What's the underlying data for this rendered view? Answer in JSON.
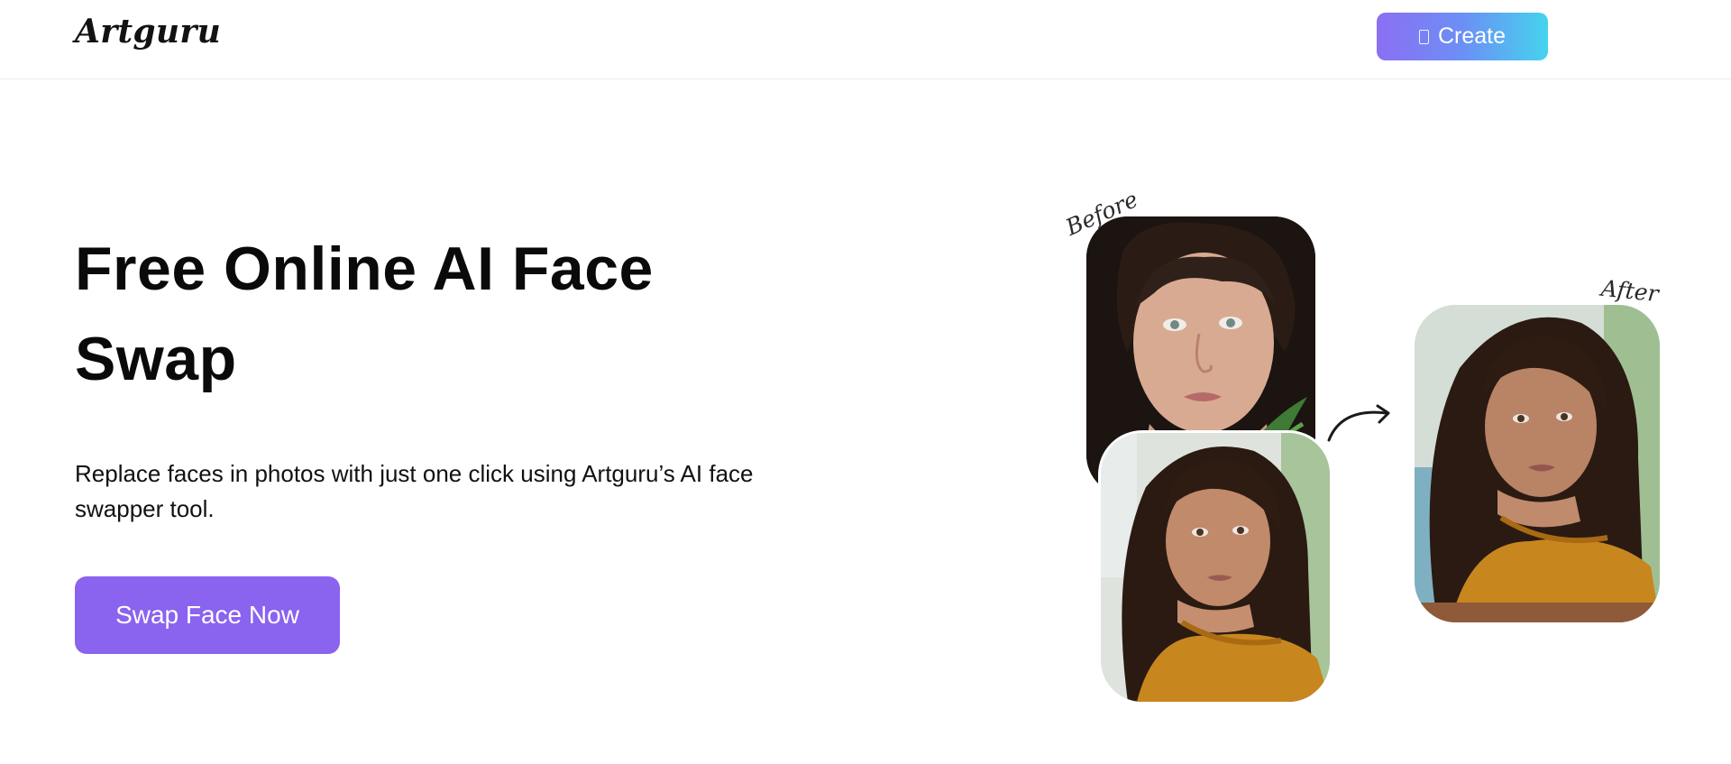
{
  "header": {
    "logo": "Artguru",
    "create_label": "Create"
  },
  "hero": {
    "title": "Free Online AI Face Swap",
    "description": "Replace faces in photos with just one click using Artguru’s AI face swapper tool.",
    "cta_label": "Swap Face Now"
  },
  "illustration": {
    "before_label": "Before",
    "after_label": "After"
  },
  "colors": {
    "cta": "#8a63ef",
    "create_gradient_start": "#8b6ff3",
    "create_gradient_end": "#45d3ee"
  }
}
